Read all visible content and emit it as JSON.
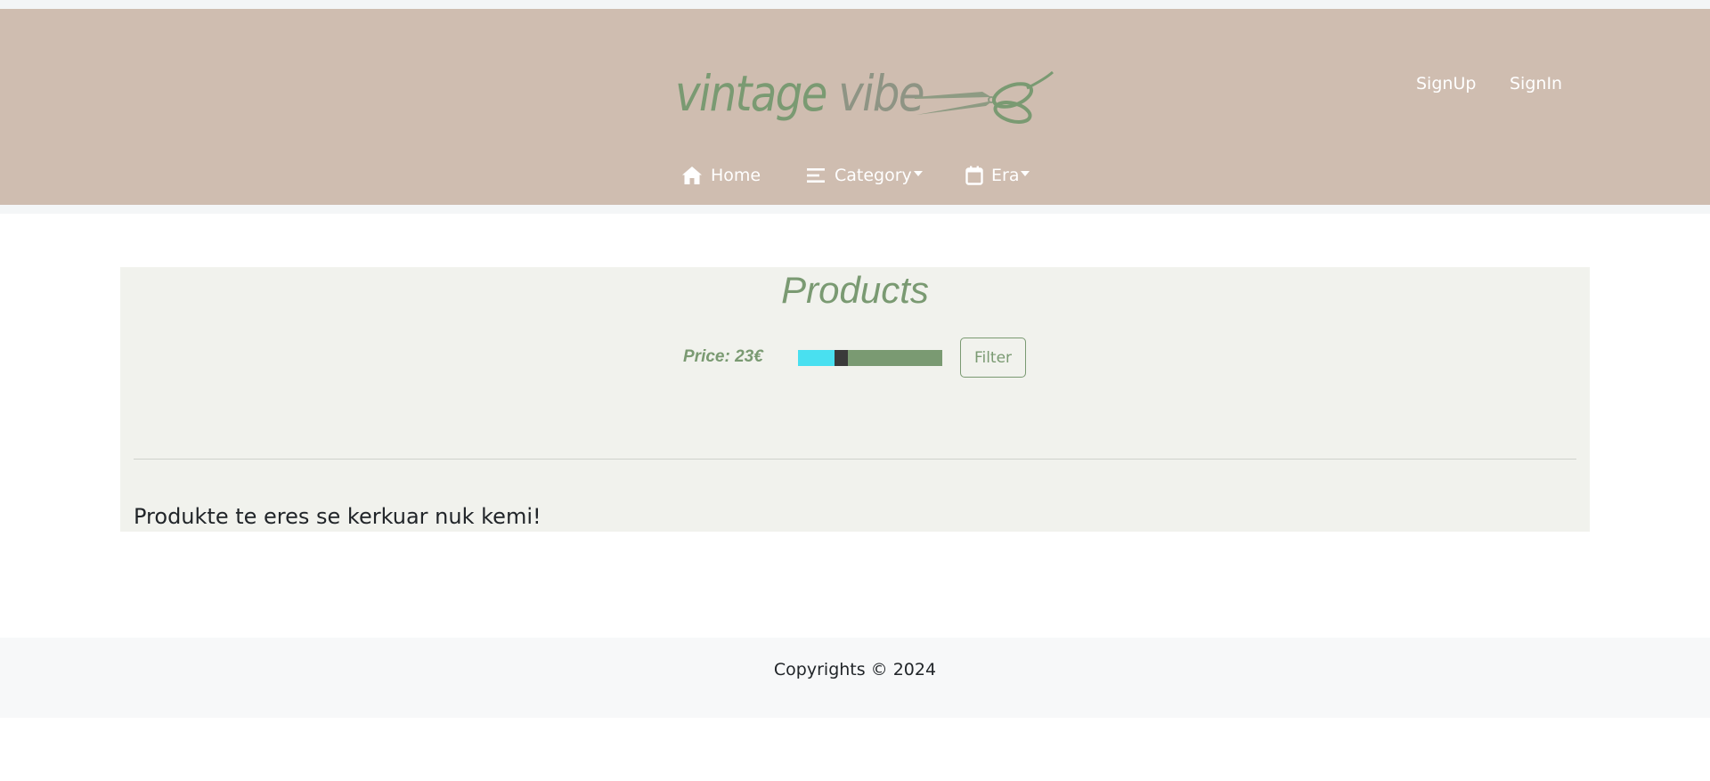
{
  "header": {
    "logo": {
      "word1": "vintage",
      "word2": "vibe",
      "icon": "scissors-icon"
    },
    "auth": {
      "signup_label": "SignUp",
      "signin_label": "SignIn"
    },
    "nav": [
      {
        "label": "Home",
        "icon": "home-icon",
        "dropdown": false
      },
      {
        "label": "Category",
        "icon": "list-icon",
        "dropdown": true
      },
      {
        "label": "Era",
        "icon": "calendar-icon",
        "dropdown": true
      }
    ]
  },
  "products": {
    "title": "Products",
    "price_label": "Price: 23€",
    "price_slider": {
      "position_fraction": 0.28
    },
    "filter_label": "Filter",
    "empty_message": "Produkte te eres se kerkuar nuk kemi!"
  },
  "footer": {
    "copyright": "Copyrights © 2024"
  },
  "colors": {
    "header_bg": "#cfbdb0",
    "accent_green": "#7a9a72",
    "slider_fill": "#49e0f0",
    "panel_bg": "#f1f2ed",
    "footer_bg": "#f7f8f9"
  }
}
